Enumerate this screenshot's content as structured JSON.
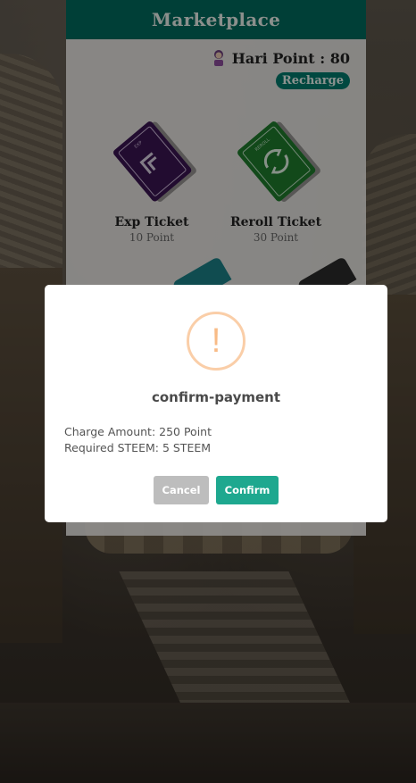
{
  "marketplace": {
    "title": "Marketplace",
    "points_label": "Hari Point : 80",
    "recharge_label": "Recharge",
    "items": [
      {
        "name": "Exp Ticket",
        "price": "10 Point",
        "ticket_text": "EXP",
        "color": "#3a1450"
      },
      {
        "name": "Reroll Ticket",
        "price": "30 Point",
        "ticket_text": "REROLL",
        "color": "#1e7a2c"
      }
    ]
  },
  "dialog": {
    "title": "confirm-payment",
    "icon_glyph": "!",
    "lines": [
      "Charge Amount: 250 Point",
      "Required STEEM: 5 STEEM"
    ],
    "cancel_label": "Cancel",
    "confirm_label": "Confirm"
  },
  "colors": {
    "header": "#00695c",
    "confirm": "#1ea88f",
    "cancel": "#bdbdbd",
    "warning": "#f8bb86"
  }
}
